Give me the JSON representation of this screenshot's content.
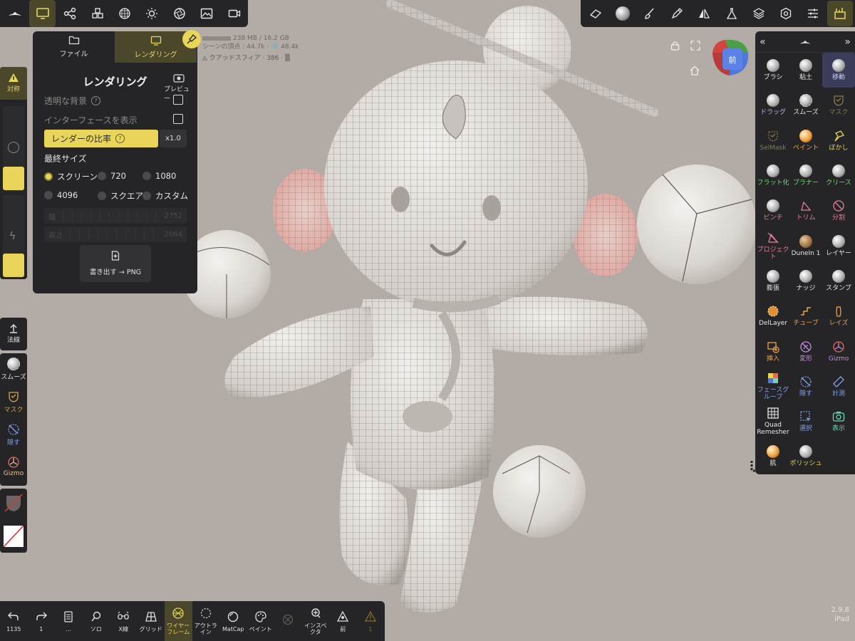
{
  "colors": {
    "accent": "#e8d55a",
    "panel": "#252527",
    "background": "#b3aba5",
    "active_tool": "#3b3d5a"
  },
  "top_left_toolbar": {
    "items": [
      {
        "icon": "hat-logo-icon"
      },
      {
        "icon": "monitor-icon",
        "active": true
      },
      {
        "icon": "share-nodes-icon"
      },
      {
        "icon": "cubes-icon"
      },
      {
        "icon": "sphere-grid-icon"
      },
      {
        "icon": "sun-icon"
      },
      {
        "icon": "aperture-icon"
      },
      {
        "icon": "image-icon"
      },
      {
        "icon": "video-camera-icon"
      }
    ]
  },
  "top_right_toolbar": {
    "items": [
      {
        "icon": "eraser-icon"
      },
      {
        "icon": "matcap-sphere-icon"
      },
      {
        "icon": "brush-icon"
      },
      {
        "icon": "pen-icon"
      },
      {
        "icon": "symmetry-icon"
      },
      {
        "icon": "flask-icon"
      },
      {
        "icon": "layers-icon"
      },
      {
        "icon": "settings-icon"
      },
      {
        "icon": "sliders-icon"
      },
      {
        "icon": "toolbox-icon",
        "active": true
      }
    ]
  },
  "render_panel": {
    "tabs": [
      {
        "label": "ファイル"
      },
      {
        "label": "レンダリング"
      }
    ],
    "title": "レンダリング",
    "preview_label": "プレビュー",
    "transparent_bg_label": "透明な背景",
    "show_interface_label": "インターフェースを表示",
    "render_ratio_label": "レンダーの比率",
    "render_ratio_value": "x1.0",
    "final_size_label": "最終サイズ",
    "size_options": [
      {
        "label": "スクリーン",
        "selected": true
      },
      {
        "label": "720"
      },
      {
        "label": "1080"
      },
      {
        "label": "4096"
      },
      {
        "label": "スクエア"
      },
      {
        "label": "カスタム"
      }
    ],
    "width_label": "幅",
    "width_value": "2752",
    "height_label": "高さ",
    "height_value": "2064",
    "export_label": "書き出す → PNG"
  },
  "scene_info": {
    "memory": "238 MB / 16.2 GB",
    "vertices": "シーンの頂点 : 44.7k · 🔗 48.4k",
    "object": "クアッドスフィア · 386 · ▒"
  },
  "left_tools": {
    "symmetry_label": "対称",
    "normal_label": "法線",
    "smooth_label": "スムーズ",
    "mask_label": "マスク",
    "hide_label": "隠す",
    "gizmo_label": "Gizmo"
  },
  "right_panel": {
    "tools": [
      {
        "label": "ブラシ",
        "icon": "brush-sphere-icon"
      },
      {
        "label": "粘土",
        "icon": "clay-icon"
      },
      {
        "label": "移動",
        "icon": "move-icon",
        "active": true
      },
      {
        "label": "ドラッグ",
        "icon": "drag-icon"
      },
      {
        "label": "スムーズ",
        "icon": "smooth-icon"
      },
      {
        "label": "マスク",
        "icon": "mask-icon"
      },
      {
        "label": "SelMask",
        "icon": "selmask-icon"
      },
      {
        "label": "ペイント",
        "icon": "paint-icon"
      },
      {
        "label": "ぼかし",
        "icon": "smudge-icon"
      },
      {
        "label": "フラット化",
        "icon": "flatten-icon"
      },
      {
        "label": "プラナー",
        "icon": "planar-icon"
      },
      {
        "label": "クリース",
        "icon": "crease-icon"
      },
      {
        "label": "ピンチ",
        "icon": "pinch-icon"
      },
      {
        "label": "トリム",
        "icon": "trim-icon"
      },
      {
        "label": "分割",
        "icon": "split-icon"
      },
      {
        "label": "プロジェクト",
        "icon": "project-icon"
      },
      {
        "label": "DuneIn 1",
        "icon": "dunein-icon"
      },
      {
        "label": "レイヤー",
        "icon": "layer-icon"
      },
      {
        "label": "膨張",
        "icon": "inflate-icon"
      },
      {
        "label": "ナッジ",
        "icon": "nudge-icon"
      },
      {
        "label": "スタンプ",
        "icon": "stamp-icon"
      },
      {
        "label": "DelLayer",
        "icon": "dellayer-icon"
      },
      {
        "label": "チューブ",
        "icon": "tube-icon"
      },
      {
        "label": "レイズ",
        "icon": "lathe-icon"
      },
      {
        "label": "挿入",
        "icon": "insert-icon"
      },
      {
        "label": "変形",
        "icon": "transform-icon"
      },
      {
        "label": "Gizmo",
        "icon": "gizmo-icon"
      },
      {
        "label": "フェースグループ",
        "icon": "facegroup-icon"
      },
      {
        "label": "隠す",
        "icon": "hide-icon"
      },
      {
        "label": "計測",
        "icon": "measure-icon"
      },
      {
        "label": "Quad Remesher",
        "icon": "quad-remesher-icon"
      },
      {
        "label": "選択",
        "icon": "select-icon"
      },
      {
        "label": "表示",
        "icon": "view-icon"
      },
      {
        "label": "肌",
        "icon": "skin-icon"
      },
      {
        "label": "ポリッシュ",
        "icon": "polish-icon"
      }
    ]
  },
  "bottom_toolbar": {
    "items": [
      {
        "label": "1135",
        "icon": "undo-icon"
      },
      {
        "label": "1",
        "icon": "redo-icon"
      },
      {
        "label": "...",
        "icon": "history-icon"
      },
      {
        "label": "ソロ",
        "icon": "solo-icon"
      },
      {
        "label": "X線",
        "icon": "xray-icon"
      },
      {
        "label": "グリッド",
        "icon": "grid-icon"
      },
      {
        "label": "ワイヤーフレーム",
        "icon": "wireframe-icon",
        "active": true
      },
      {
        "label": "アウトライン",
        "icon": "outline-icon"
      },
      {
        "label": "MatCap",
        "icon": "matcap-icon"
      },
      {
        "label": "ペイント",
        "icon": "paint-palette-icon"
      },
      {
        "label": "",
        "icon": "disabled-icon",
        "dim": true
      },
      {
        "label": "インスペクタ",
        "icon": "inspector-icon"
      },
      {
        "label": "前",
        "icon": "front-view-icon"
      },
      {
        "label": "1",
        "icon": "warning-icon",
        "dim": true
      }
    ]
  },
  "view_cube_label": "前",
  "version": {
    "number": "2.9.8",
    "device": "iPad"
  }
}
